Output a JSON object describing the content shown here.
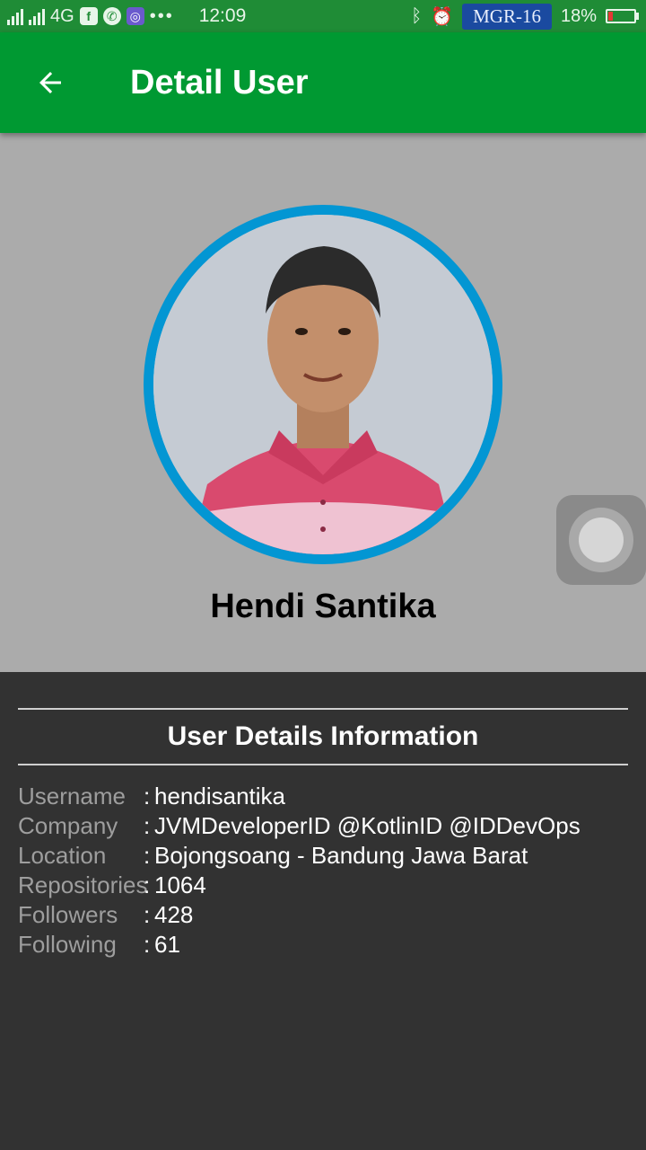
{
  "status_bar": {
    "network": "4G",
    "time": "12:09",
    "operator": "MGR-16",
    "battery": "18%",
    "battery_level": 0.18,
    "icons": [
      "signal-icon",
      "facebook-icon",
      "whatsapp-icon",
      "app-icon",
      "bluetooth-icon",
      "alarm-icon",
      "battery-icon"
    ]
  },
  "app_bar": {
    "title": "Detail User",
    "back_icon": "arrow-left-icon"
  },
  "profile": {
    "name": "Hendi Santika"
  },
  "details": {
    "section_title": "User Details Information",
    "rows": [
      {
        "label": "Username",
        "value": "hendisantika"
      },
      {
        "label": "Company",
        "value": "JVMDeveloperID @KotlinID @IDDevOps"
      },
      {
        "label": "Location",
        "value": "Bojongsoang - Bandung Jawa Barat"
      },
      {
        "label": "Repositories",
        "value": "1064"
      },
      {
        "label": "Followers",
        "value": "428"
      },
      {
        "label": "Following",
        "value": "61"
      }
    ],
    "separator": ":"
  },
  "colors": {
    "app_bar": "#009932",
    "status_bar": "#1f8c36",
    "avatar_ring": "#0396d3",
    "profile_bg": "#ababab",
    "details_bg": "#323232"
  }
}
